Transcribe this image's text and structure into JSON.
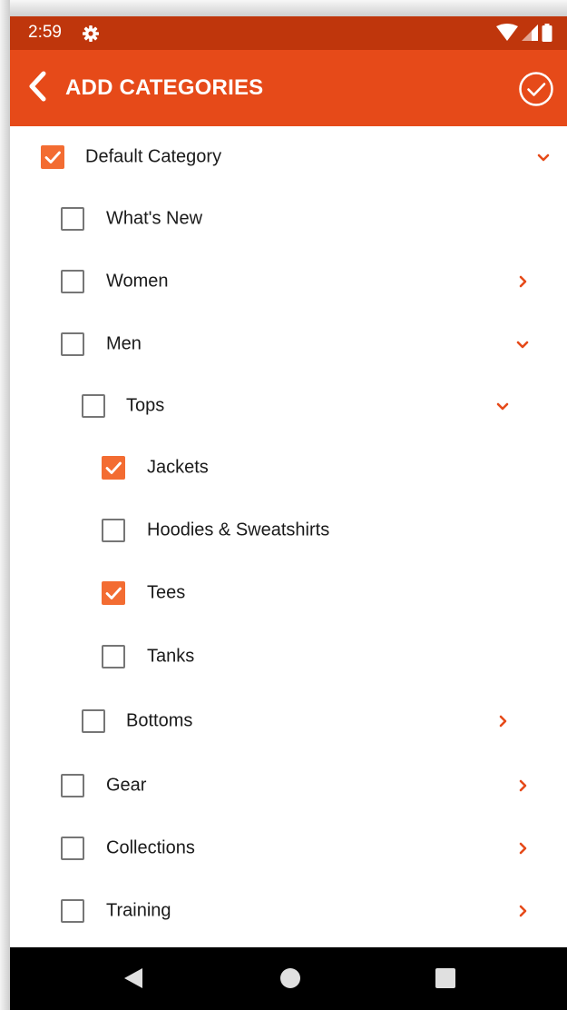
{
  "status_bar": {
    "time": "2:59"
  },
  "app_bar": {
    "title": "ADD CATEGORIES"
  },
  "theme": {
    "primary": "#e64a19",
    "primary_dark": "#bf360c",
    "accent": "#f36c32",
    "checkbox_off": "#767676"
  },
  "categories": [
    {
      "label": "Default Category",
      "checked": true,
      "expander": "chevron-down-icon"
    },
    {
      "label": "What's New",
      "checked": false,
      "expander": ""
    },
    {
      "label": "Women",
      "checked": false,
      "expander": "chevron-right-icon"
    },
    {
      "label": "Men",
      "checked": false,
      "expander": "chevron-down-icon"
    },
    {
      "label": "Tops",
      "checked": false,
      "expander": "chevron-down-icon"
    },
    {
      "label": "Jackets",
      "checked": true,
      "expander": ""
    },
    {
      "label": "Hoodies & Sweatshirts",
      "checked": false,
      "expander": ""
    },
    {
      "label": "Tees",
      "checked": true,
      "expander": ""
    },
    {
      "label": "Tanks",
      "checked": false,
      "expander": ""
    },
    {
      "label": "Bottoms",
      "checked": false,
      "expander": "chevron-right-icon"
    },
    {
      "label": "Gear",
      "checked": false,
      "expander": "chevron-right-icon"
    },
    {
      "label": "Collections",
      "checked": false,
      "expander": "chevron-right-icon"
    },
    {
      "label": "Training",
      "checked": false,
      "expander": "chevron-right-icon"
    }
  ]
}
